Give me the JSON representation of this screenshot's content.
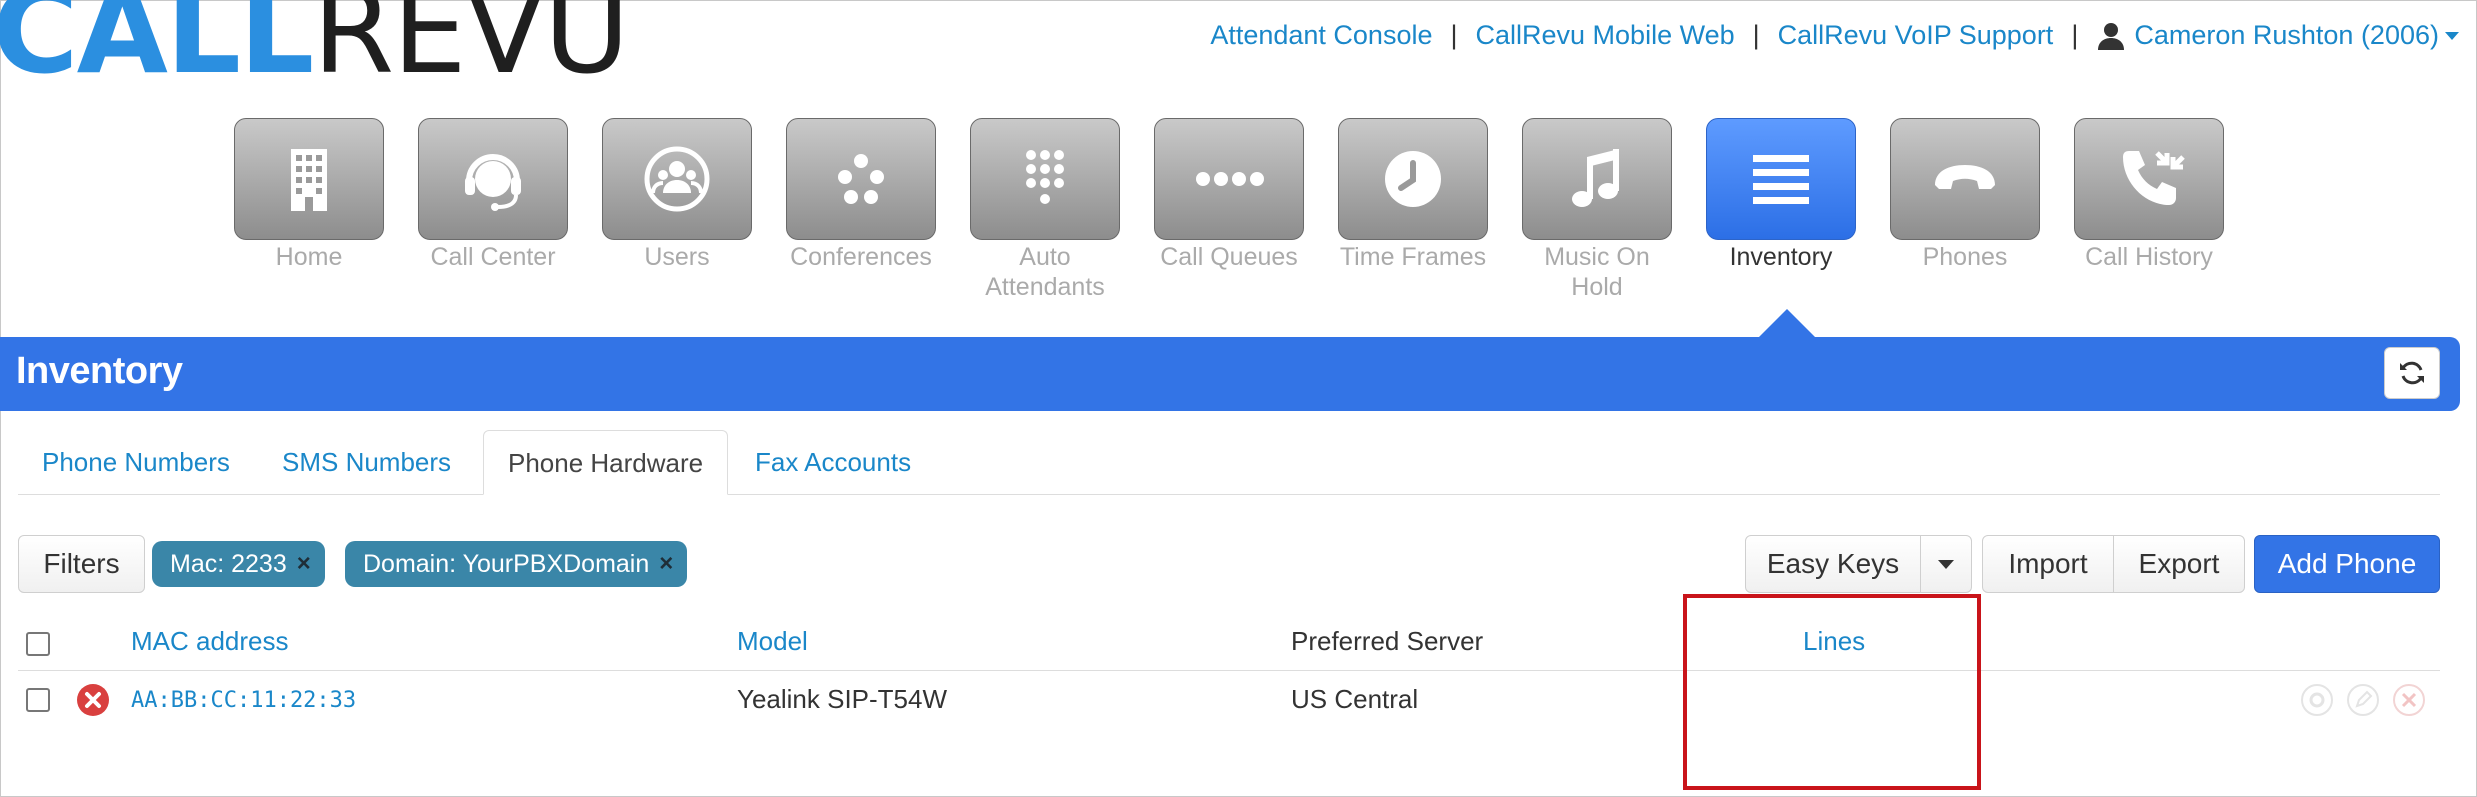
{
  "logo": {
    "part1": "CALL",
    "part2": "REVU"
  },
  "toplinks": {
    "attendant_console": "Attendant Console",
    "mobile_web": "CallRevu Mobile Web",
    "voip_support": "CallRevu VoIP Support",
    "separator": "|",
    "user": "Cameron Rushton (2006)"
  },
  "nav": {
    "items": [
      {
        "label": "Home",
        "icon": "building-icon"
      },
      {
        "label": "Call Center",
        "icon": "headset-icon"
      },
      {
        "label": "Users",
        "icon": "users-icon"
      },
      {
        "label": "Conferences",
        "icon": "conference-dots-icon"
      },
      {
        "label": "Auto Attendants",
        "icon": "keypad-icon"
      },
      {
        "label": "Call Queues",
        "icon": "queue-dots-icon"
      },
      {
        "label": "Time Frames",
        "icon": "clock-icon"
      },
      {
        "label": "Music On Hold",
        "icon": "music-note-icon"
      },
      {
        "label": "Inventory",
        "icon": "list-icon",
        "active": true
      },
      {
        "label": "Phones",
        "icon": "phone-handset-icon"
      },
      {
        "label": "Call History",
        "icon": "call-history-icon"
      }
    ]
  },
  "banner": {
    "title": "Inventory"
  },
  "tabs": [
    {
      "label": "Phone Numbers"
    },
    {
      "label": "SMS Numbers"
    },
    {
      "label": "Phone Hardware",
      "active": true
    },
    {
      "label": "Fax Accounts"
    }
  ],
  "toolbar": {
    "filters": "Filters",
    "chip_mac": "Mac: 2233",
    "chip_domain": "Domain: YourPBXDomain",
    "chip_remove": "×",
    "easy_keys": "Easy Keys",
    "import": "Import",
    "export": "Export",
    "add_phone": "Add Phone"
  },
  "table": {
    "headers": {
      "mac": "MAC address",
      "model": "Model",
      "server": "Preferred Server",
      "lines": "Lines"
    },
    "rows": [
      {
        "mac": "AA:BB:CC:11:22:33",
        "model": "Yealink SIP-T54W",
        "server": "US Central",
        "lines": ""
      }
    ]
  },
  "colors": {
    "brand_blue": "#3374e6",
    "link": "#1a87c9",
    "chip": "#3a86a8",
    "highlight": "#c9141a"
  }
}
